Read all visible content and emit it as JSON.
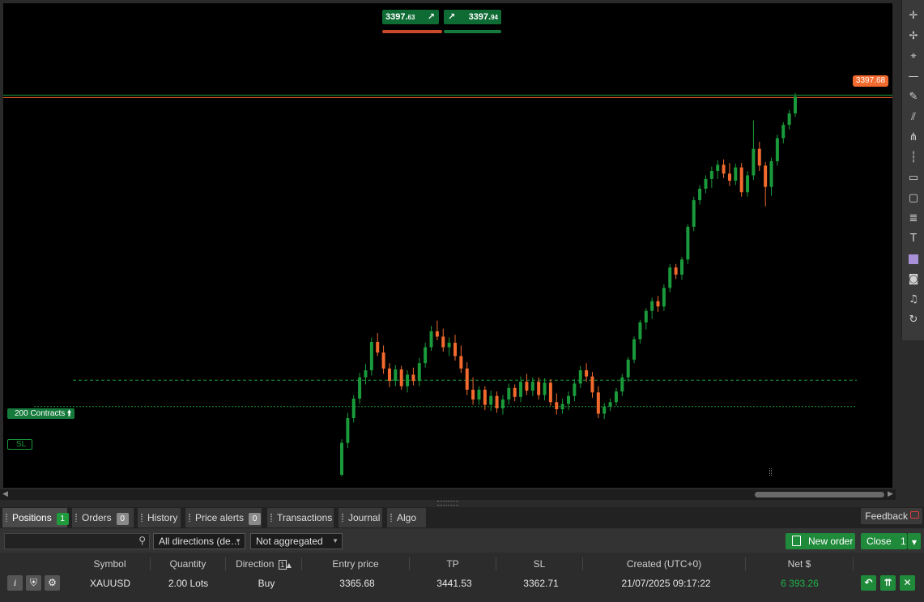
{
  "quote": {
    "sell_main": "3397.",
    "sell_small": "63",
    "buy_main": "3397.",
    "buy_small": "94",
    "sell_arrow": "↗",
    "buy_arrow": "↗"
  },
  "price_label": "3397.68",
  "position_line_label": "200 Contracts",
  "position_line_icon": "arrow-up-icon",
  "sl_line_label": "SL",
  "colors": {
    "up": "#1a9a3a",
    "down": "#f26a2e",
    "accent": "#1f8a3a",
    "price_tag": "#f26a2e"
  },
  "tabs": [
    {
      "label": "Positions",
      "count": "1"
    },
    {
      "label": "Orders",
      "count": "0"
    },
    {
      "label": "History",
      "count": ""
    },
    {
      "label": "Price alerts",
      "count": "0"
    },
    {
      "label": "Transactions",
      "count": ""
    },
    {
      "label": "Journal",
      "count": ""
    },
    {
      "label": "Algo",
      "count": ""
    }
  ],
  "feedback_label": "Feedback",
  "filters": {
    "search_placeholder": "",
    "direction": "All directions (de…",
    "aggregation": "Not aggregated"
  },
  "actions": {
    "new_order": "New order",
    "close": "Close",
    "close_count": "1"
  },
  "table": {
    "headers": [
      "Symbol",
      "Quantity",
      "Direction",
      "Entry price",
      "TP",
      "SL",
      "Created (UTC+0)",
      "Net $"
    ],
    "direction_sort_index": "1",
    "row": {
      "symbol": "XAUUSD",
      "quantity": "2.00 Lots",
      "direction": "Buy",
      "entry_price": "3365.68",
      "tp": "3441.53",
      "sl": "3362.71",
      "created": "21/07/2025 09:17:22",
      "net": "6 393.26"
    }
  },
  "toolbar_icons": [
    "crosshair-icon",
    "cursor-icon",
    "measure-icon",
    "horizontal-line-icon",
    "pen-icon",
    "fib-icon",
    "pitchfork-icon",
    "ruler-icon",
    "rectangle-icon",
    "shape-icon",
    "text-levels-icon",
    "text-icon",
    "color-swatch-icon",
    "camera-icon",
    "bell-icon",
    "replay-icon"
  ],
  "chart_data": {
    "type": "candlestick",
    "symbol": "XAUUSD",
    "x_axis": "hidden",
    "y_axis": "hidden",
    "y_range": [
      3355,
      3400
    ],
    "horizontal_levels": {
      "position_entry": 3365.68,
      "stop_loss": 3362.71,
      "current_price": 3397.68
    },
    "candles_ohlc": [
      [
        3355.0,
        3359.0,
        3354.8,
        3358.6
      ],
      [
        3358.6,
        3362.0,
        3358.0,
        3361.4
      ],
      [
        3361.4,
        3364.0,
        3360.9,
        3363.6
      ],
      [
        3363.6,
        3366.5,
        3363.0,
        3366.0
      ],
      [
        3366.0,
        3367.5,
        3365.2,
        3366.8
      ],
      [
        3366.8,
        3370.5,
        3366.2,
        3370.0
      ],
      [
        3370.0,
        3371.0,
        3368.4,
        3368.8
      ],
      [
        3368.8,
        3369.6,
        3366.4,
        3367.0
      ],
      [
        3367.0,
        3367.6,
        3364.9,
        3365.6
      ],
      [
        3365.6,
        3367.4,
        3365.0,
        3366.9
      ],
      [
        3366.9,
        3367.3,
        3364.6,
        3365.0
      ],
      [
        3365.0,
        3366.8,
        3364.3,
        3366.3
      ],
      [
        3366.3,
        3367.1,
        3365.1,
        3365.6
      ],
      [
        3365.6,
        3368.2,
        3365.0,
        3367.6
      ],
      [
        3367.6,
        3369.9,
        3367.1,
        3369.4
      ],
      [
        3369.4,
        3371.8,
        3369.0,
        3371.2
      ],
      [
        3371.2,
        3372.4,
        3370.2,
        3370.6
      ],
      [
        3370.6,
        3371.5,
        3368.9,
        3369.4
      ],
      [
        3369.4,
        3370.5,
        3368.4,
        3369.9
      ],
      [
        3369.9,
        3370.8,
        3367.9,
        3368.4
      ],
      [
        3368.4,
        3369.6,
        3366.5,
        3367.0
      ],
      [
        3367.0,
        3367.7,
        3364.0,
        3364.6
      ],
      [
        3364.6,
        3366.0,
        3362.9,
        3363.5
      ],
      [
        3363.5,
        3365.0,
        3362.9,
        3364.6
      ],
      [
        3364.6,
        3365.0,
        3362.3,
        3362.9
      ],
      [
        3362.9,
        3364.5,
        3362.2,
        3363.9
      ],
      [
        3363.9,
        3364.4,
        3362.0,
        3362.5
      ],
      [
        3362.5,
        3364.0,
        3361.8,
        3363.5
      ],
      [
        3363.5,
        3365.3,
        3362.9,
        3364.8
      ],
      [
        3364.8,
        3365.2,
        3363.3,
        3363.8
      ],
      [
        3363.8,
        3366.1,
        3363.2,
        3365.5
      ],
      [
        3365.5,
        3366.4,
        3364.0,
        3364.5
      ],
      [
        3364.5,
        3366.0,
        3363.9,
        3365.5
      ],
      [
        3365.5,
        3366.0,
        3363.5,
        3364.0
      ],
      [
        3364.0,
        3365.9,
        3363.4,
        3365.4
      ],
      [
        3365.4,
        3365.8,
        3362.8,
        3363.2
      ],
      [
        3363.2,
        3364.2,
        3361.8,
        3362.4
      ],
      [
        3362.4,
        3363.6,
        3361.9,
        3363.0
      ],
      [
        3363.0,
        3364.4,
        3362.3,
        3363.9
      ],
      [
        3363.9,
        3365.8,
        3363.3,
        3365.3
      ],
      [
        3365.3,
        3367.3,
        3364.8,
        3366.8
      ],
      [
        3366.8,
        3367.6,
        3365.5,
        3366.1
      ],
      [
        3366.1,
        3366.6,
        3363.7,
        3364.3
      ],
      [
        3364.3,
        3365.0,
        3361.4,
        3361.9
      ],
      [
        3361.9,
        3363.1,
        3361.3,
        3362.7
      ],
      [
        3362.7,
        3363.6,
        3362.2,
        3363.2
      ],
      [
        3363.2,
        3364.8,
        3362.8,
        3364.4
      ],
      [
        3364.4,
        3366.4,
        3363.9,
        3366.0
      ],
      [
        3366.0,
        3368.3,
        3365.5,
        3368.0
      ],
      [
        3368.0,
        3370.6,
        3367.6,
        3370.3
      ],
      [
        3370.3,
        3372.5,
        3369.8,
        3372.2
      ],
      [
        3372.2,
        3373.8,
        3371.4,
        3373.5
      ],
      [
        3373.5,
        3375.0,
        3372.6,
        3374.6
      ],
      [
        3374.6,
        3375.2,
        3373.4,
        3374.0
      ],
      [
        3374.0,
        3376.5,
        3373.5,
        3376.1
      ],
      [
        3376.1,
        3378.8,
        3375.6,
        3378.4
      ],
      [
        3378.4,
        3378.8,
        3377.1,
        3377.6
      ],
      [
        3377.6,
        3379.6,
        3377.0,
        3379.3
      ],
      [
        3379.3,
        3383.3,
        3378.8,
        3383.0
      ],
      [
        3383.0,
        3386.4,
        3382.5,
        3386.0
      ],
      [
        3386.0,
        3387.7,
        3385.5,
        3387.3
      ],
      [
        3387.3,
        3388.8,
        3386.8,
        3388.4
      ],
      [
        3388.4,
        3389.8,
        3387.4,
        3389.3
      ],
      [
        3389.3,
        3390.5,
        3388.4,
        3390.0
      ],
      [
        3390.0,
        3390.6,
        3388.5,
        3389.0
      ],
      [
        3389.0,
        3390.2,
        3387.6,
        3388.2
      ],
      [
        3388.2,
        3390.1,
        3387.7,
        3389.7
      ],
      [
        3389.7,
        3390.2,
        3386.4,
        3386.9
      ],
      [
        3386.9,
        3389.3,
        3386.4,
        3388.8
      ],
      [
        3388.8,
        3395.0,
        3388.3,
        3391.8
      ],
      [
        3391.8,
        3392.6,
        3389.3,
        3389.9
      ],
      [
        3389.9,
        3390.3,
        3385.3,
        3387.5
      ],
      [
        3387.5,
        3390.8,
        3386.5,
        3390.4
      ],
      [
        3390.4,
        3393.4,
        3389.9,
        3393.0
      ],
      [
        3393.0,
        3394.8,
        3392.4,
        3394.5
      ],
      [
        3394.5,
        3396.2,
        3394.0,
        3395.8
      ],
      [
        3395.8,
        3398.1,
        3395.4,
        3397.7
      ]
    ]
  }
}
